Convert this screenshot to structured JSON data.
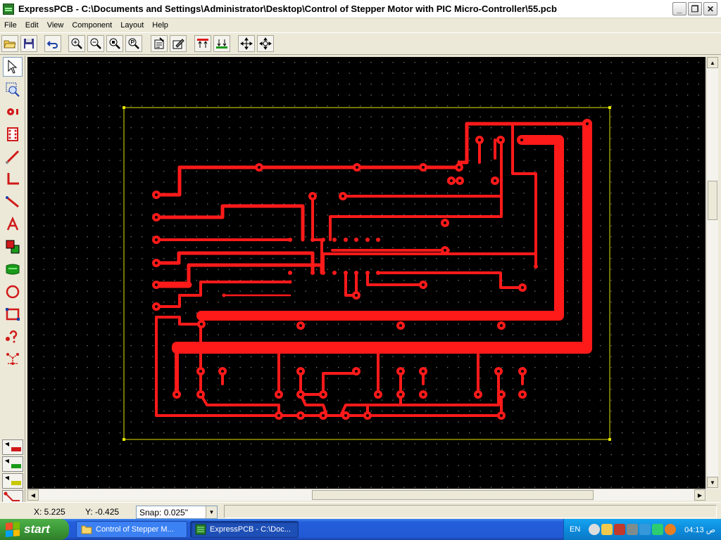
{
  "window": {
    "title": "ExpressPCB - C:\\Documents and Settings\\Administrator\\Desktop\\Control of Stepper Motor with PIC Micro-Controller\\55.pcb",
    "min_glyph": "_",
    "max_glyph": "❐",
    "close_glyph": "✕"
  },
  "menu": [
    "File",
    "Edit",
    "View",
    "Component",
    "Layout",
    "Help"
  ],
  "toolbar_icons": [
    "open-icon",
    "save-icon",
    "undo-icon",
    "zoom-in-icon",
    "zoom-out-icon",
    "zoom-fit-icon",
    "zoom-actual-icon",
    "properties-icon",
    "edit-icon",
    "top-layer-icon",
    "bottom-layer-icon",
    "move-icon",
    "rotate-icon"
  ],
  "palette_icons": [
    "pointer-icon",
    "zoom-select-icon",
    "pad-icon",
    "component-icon",
    "trace-icon",
    "corner-trace-icon",
    "diagonal-trace-icon",
    "text-icon",
    "filled-planes-icon",
    "silkscreen-icon",
    "circle-icon",
    "rectangle-icon",
    "query-icon",
    "netlist-icon"
  ],
  "layer_buttons": [
    "top-layer-toggle-icon",
    "bottom-layer-toggle-icon",
    "silk-layer-toggle-icon",
    "rats-nest-icon"
  ],
  "status": {
    "x_label": "X: 5.225",
    "y_label": "Y: -0.425",
    "snap_label": "Snap:  0.025\""
  },
  "colors": {
    "trace": "#ff1a1a",
    "board_outline": "#e6e600",
    "canvas_bg": "#000000",
    "grid_dot": "#808080"
  },
  "taskbar": {
    "start_label": "start",
    "tasks": [
      {
        "label": "Control of Stepper M...",
        "icon": "folder-icon"
      },
      {
        "label": "ExpressPCB - C:\\Doc...",
        "icon": "expresspcb-icon"
      }
    ],
    "language": "EN",
    "clock": "04:13 ص"
  }
}
